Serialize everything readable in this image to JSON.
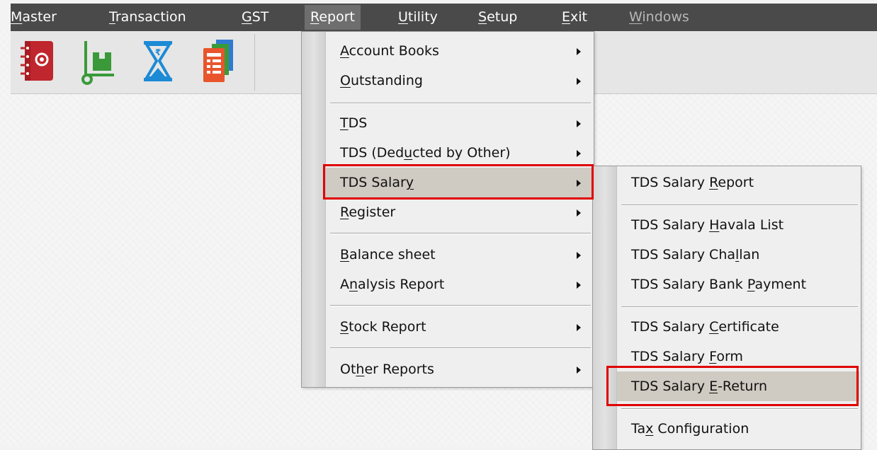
{
  "menubar": [
    {
      "label": "Master",
      "mn": "M",
      "rest": "aster"
    },
    {
      "label": "Transaction",
      "mn": "T",
      "rest": "ransaction"
    },
    {
      "label": "GST",
      "mn": "G",
      "rest": "ST"
    },
    {
      "label": "Report",
      "mn": "R",
      "rest": "eport"
    },
    {
      "label": "Utility",
      "mn": "U",
      "rest": "tility"
    },
    {
      "label": "Setup",
      "mn": "S",
      "rest": "etup"
    },
    {
      "label": "Exit",
      "mn": "E",
      "rest": "xit"
    },
    {
      "label": "Windows",
      "mn": "W",
      "rest": "indows"
    }
  ],
  "toolbar": {
    "icons": [
      "contacts-book-icon",
      "trolley-box-icon",
      "hourglass-rupee-icon",
      "documents-icon"
    ],
    "colors": {
      "red": "#c0262d",
      "green": "#3a9a3a",
      "blue": "#1d8ad6",
      "orange": "#e8552d"
    }
  },
  "report_menu": [
    {
      "pre": "",
      "mn": "A",
      "post": "ccount Books"
    },
    {
      "pre": "",
      "mn": "O",
      "post": "utstanding"
    },
    {
      "pre": "",
      "mn": "T",
      "post": "DS"
    },
    {
      "pre": "TDS (Ded",
      "mn": "u",
      "post": "cted by Other)"
    },
    {
      "pre": "TDS Salar",
      "mn": "y",
      "post": ""
    },
    {
      "pre": "",
      "mn": "R",
      "post": "egister"
    },
    {
      "pre": "",
      "mn": "B",
      "post": "alance sheet"
    },
    {
      "pre": "A",
      "mn": "n",
      "post": "alysis Report"
    },
    {
      "pre": "",
      "mn": "S",
      "post": "tock Report"
    },
    {
      "pre": "Ot",
      "mn": "h",
      "post": "er Reports"
    }
  ],
  "submenu": [
    {
      "pre": "TDS Salary ",
      "mn": "R",
      "post": "eport"
    },
    {
      "pre": "TDS Salary ",
      "mn": "H",
      "post": "avala List"
    },
    {
      "pre": "TDS Salary Cha",
      "mn": "l",
      "post": "lan"
    },
    {
      "pre": "TDS Salary Bank ",
      "mn": "P",
      "post": "ayment"
    },
    {
      "pre": "TDS Salary ",
      "mn": "C",
      "post": "ertificate"
    },
    {
      "pre": "TDS Salary ",
      "mn": "F",
      "post": "orm"
    },
    {
      "pre": "TDS Salary ",
      "mn": "E",
      "post": "-Return"
    },
    {
      "pre": "Ta",
      "mn": "x",
      "post": " Configuration"
    }
  ],
  "highlight_color": "#e00000"
}
